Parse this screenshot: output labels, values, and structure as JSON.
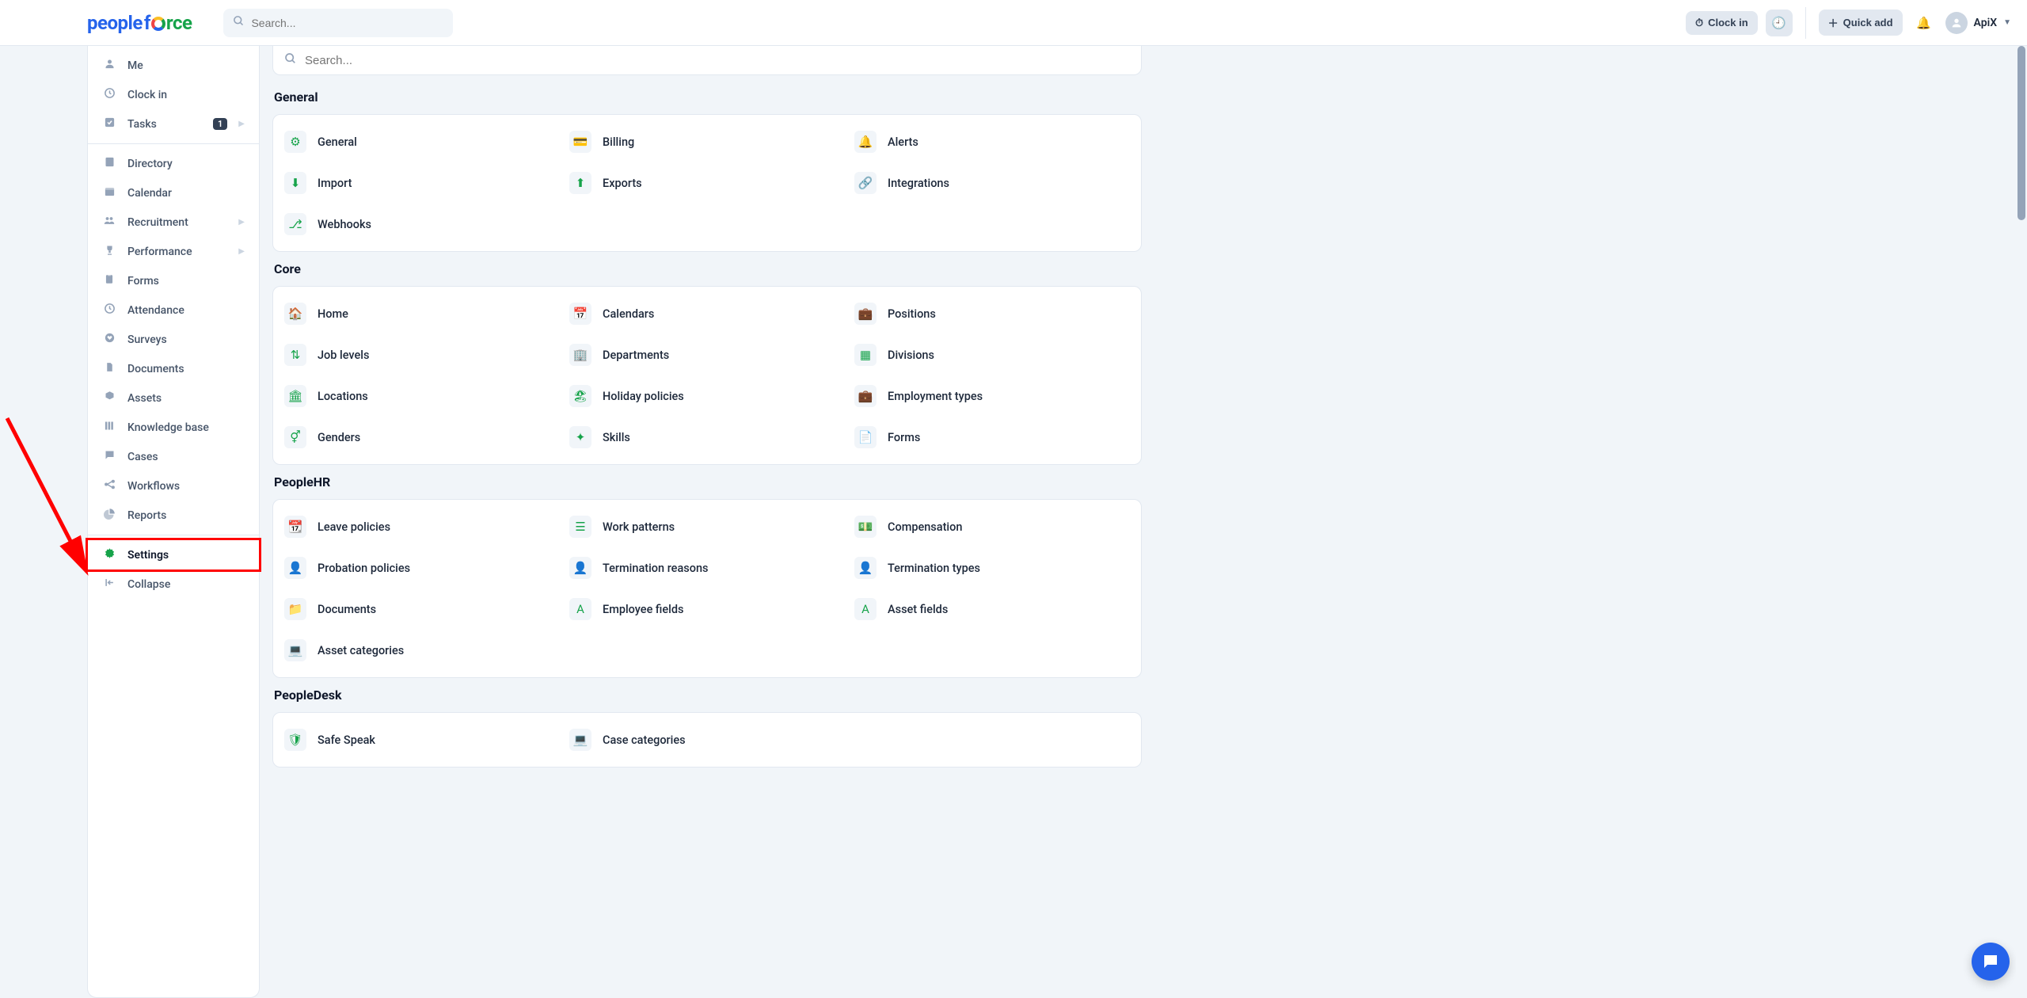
{
  "header": {
    "search_placeholder": "Search...",
    "clock_in": "Clock in",
    "quick_add": "Quick add",
    "user_name": "ApiX"
  },
  "sidebar": {
    "items_top": [
      {
        "icon": "person",
        "label": "Me"
      },
      {
        "icon": "clock",
        "label": "Clock in"
      },
      {
        "icon": "check",
        "label": "Tasks",
        "badge": "1",
        "chev": true
      }
    ],
    "items_main": [
      {
        "icon": "book",
        "label": "Directory"
      },
      {
        "icon": "calendar",
        "label": "Calendar"
      },
      {
        "icon": "people",
        "label": "Recruitment",
        "chev": true
      },
      {
        "icon": "trophy",
        "label": "Performance",
        "chev": true
      },
      {
        "icon": "clipboard",
        "label": "Forms"
      },
      {
        "icon": "clock",
        "label": "Attendance"
      },
      {
        "icon": "heart",
        "label": "Surveys"
      },
      {
        "icon": "file",
        "label": "Documents"
      },
      {
        "icon": "cube",
        "label": "Assets"
      },
      {
        "icon": "books",
        "label": "Knowledge base"
      },
      {
        "icon": "chat",
        "label": "Cases"
      },
      {
        "icon": "flow",
        "label": "Workflows"
      },
      {
        "icon": "pie",
        "label": "Reports"
      }
    ],
    "items_bottom": [
      {
        "icon": "gear",
        "label": "Settings",
        "active": true,
        "highlight": true
      },
      {
        "icon": "collapse",
        "label": "Collapse"
      }
    ]
  },
  "settings": {
    "search_placeholder": "Search...",
    "sections": [
      {
        "title": "General",
        "items": [
          {
            "icon": "sliders",
            "label": "General"
          },
          {
            "icon": "card",
            "label": "Billing"
          },
          {
            "icon": "bell",
            "label": "Alerts"
          },
          {
            "icon": "download",
            "label": "Import"
          },
          {
            "icon": "upload",
            "label": "Exports"
          },
          {
            "icon": "link",
            "label": "Integrations"
          },
          {
            "icon": "branch",
            "label": "Webhooks"
          }
        ]
      },
      {
        "title": "Core",
        "items": [
          {
            "icon": "home",
            "label": "Home"
          },
          {
            "icon": "cal",
            "label": "Calendars"
          },
          {
            "icon": "briefcase",
            "label": "Positions"
          },
          {
            "icon": "updown",
            "label": "Job levels"
          },
          {
            "icon": "org",
            "label": "Departments"
          },
          {
            "icon": "grid",
            "label": "Divisions"
          },
          {
            "icon": "building",
            "label": "Locations"
          },
          {
            "icon": "beach",
            "label": "Holiday policies"
          },
          {
            "icon": "briefcase2",
            "label": "Employment types"
          },
          {
            "icon": "gender",
            "label": "Genders"
          },
          {
            "icon": "brain",
            "label": "Skills"
          },
          {
            "icon": "file2",
            "label": "Forms"
          }
        ]
      },
      {
        "title": "PeopleHR",
        "items": [
          {
            "icon": "cal2",
            "label": "Leave policies"
          },
          {
            "icon": "lines",
            "label": "Work patterns"
          },
          {
            "icon": "money",
            "label": "Compensation"
          },
          {
            "icon": "personplus",
            "label": "Probation policies"
          },
          {
            "icon": "personx",
            "label": "Termination reasons"
          },
          {
            "icon": "persont",
            "label": "Termination types"
          },
          {
            "icon": "folder",
            "label": "Documents"
          },
          {
            "icon": "A",
            "label": "Employee fields"
          },
          {
            "icon": "A",
            "label": "Asset fields"
          },
          {
            "icon": "laptop",
            "label": "Asset categories"
          }
        ]
      },
      {
        "title": "PeopleDesk",
        "items": [
          {
            "icon": "shield",
            "label": "Safe Speak"
          },
          {
            "icon": "laptop",
            "label": "Case categories"
          }
        ]
      }
    ]
  }
}
